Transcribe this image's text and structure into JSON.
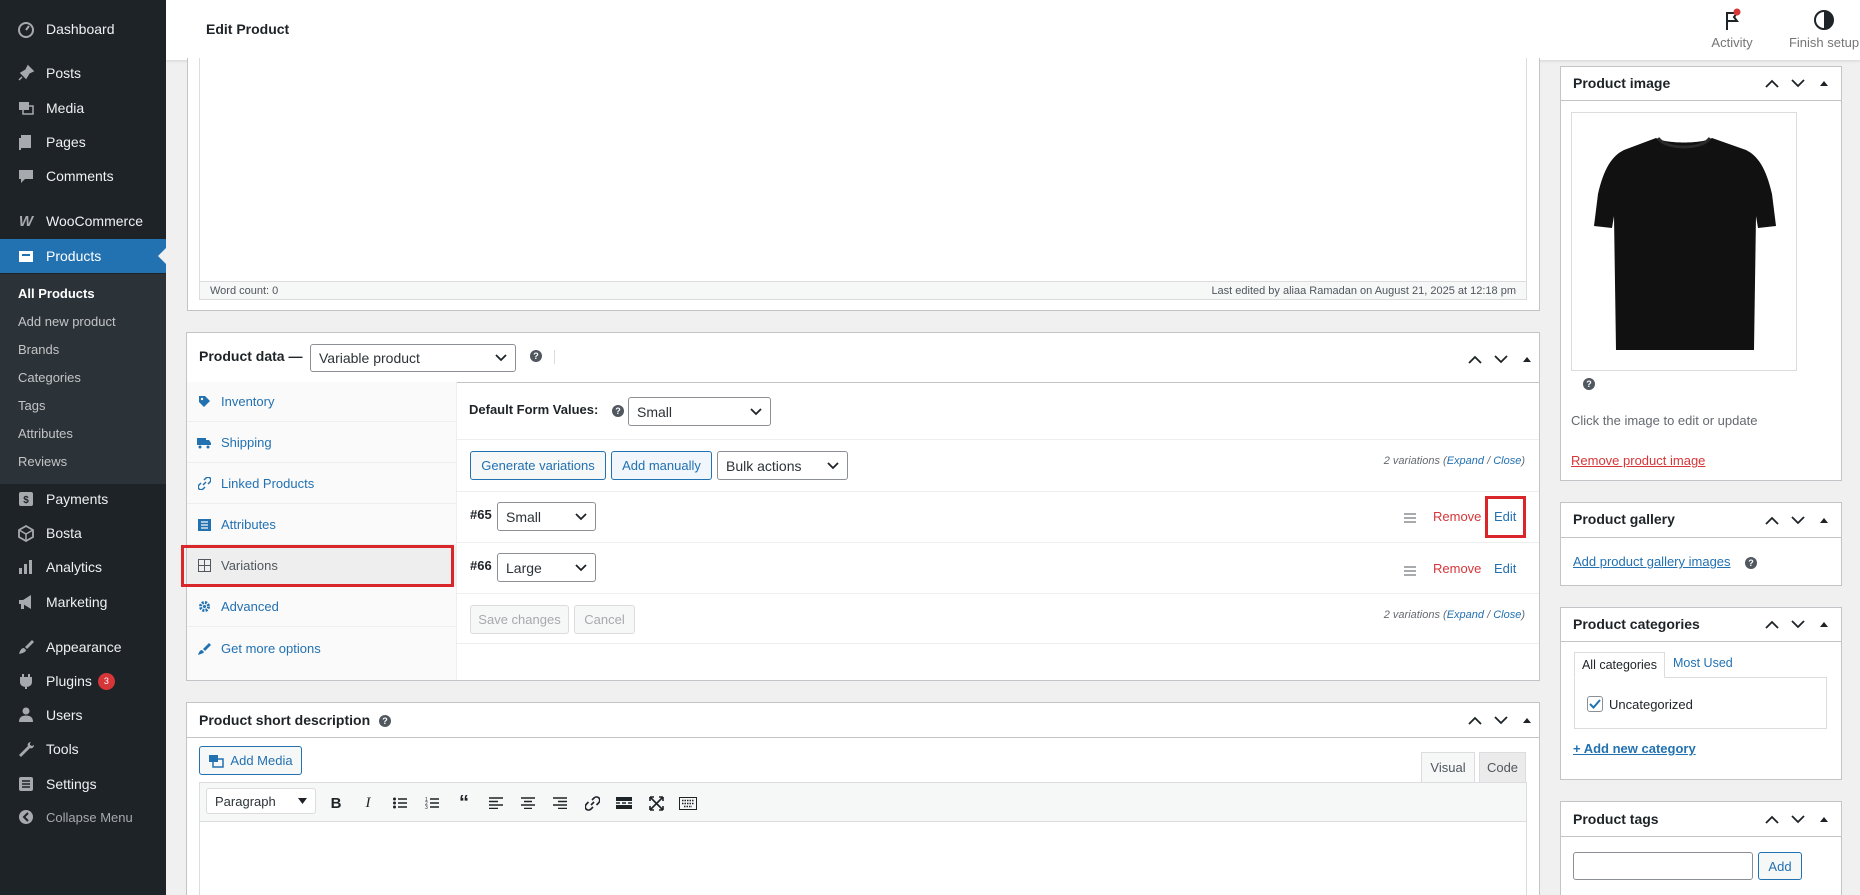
{
  "sidebar": {
    "items": [
      {
        "label": "Dashboard",
        "icon": "dashboard-icon"
      },
      {
        "label": "Posts",
        "icon": "pin-icon"
      },
      {
        "label": "Media",
        "icon": "media-icon"
      },
      {
        "label": "Pages",
        "icon": "pages-icon"
      },
      {
        "label": "Comments",
        "icon": "comments-icon"
      },
      {
        "label": "WooCommerce",
        "icon": "woocommerce-icon"
      },
      {
        "label": "Products",
        "icon": "products-icon"
      },
      {
        "label": "Payments",
        "icon": "payments-icon"
      },
      {
        "label": "Bosta",
        "icon": "bosta-icon"
      },
      {
        "label": "Analytics",
        "icon": "analytics-icon"
      },
      {
        "label": "Marketing",
        "icon": "marketing-icon"
      },
      {
        "label": "Appearance",
        "icon": "appearance-icon"
      },
      {
        "label": "Plugins",
        "icon": "plugins-icon",
        "badge": "3"
      },
      {
        "label": "Users",
        "icon": "users-icon"
      },
      {
        "label": "Tools",
        "icon": "tools-icon"
      },
      {
        "label": "Settings",
        "icon": "settings-icon"
      },
      {
        "label": "Collapse Menu",
        "icon": "collapse-icon"
      }
    ],
    "submenu": [
      "All Products",
      "Add new product",
      "Brands",
      "Categories",
      "Tags",
      "Attributes",
      "Reviews"
    ]
  },
  "topbar": {
    "title": "Edit Product",
    "activity": "Activity",
    "finish_setup": "Finish setup"
  },
  "editor": {
    "word_count": "Word count: 0",
    "last_edited": "Last edited by aliaa Ramadan on August 21, 2025 at 12:18 pm"
  },
  "product_data": {
    "title": "Product data —",
    "type": "Variable product",
    "tabs": [
      "Inventory",
      "Shipping",
      "Linked Products",
      "Attributes",
      "Variations",
      "Advanced",
      "Get more options"
    ],
    "default_form_label": "Default Form Values:",
    "default_form_value": "Small",
    "generate_btn": "Generate variations",
    "add_manually_btn": "Add manually",
    "bulk_actions": "Bulk actions",
    "variations_count": "2 variations (",
    "expand": "Expand",
    "slash": " / ",
    "close": "Close",
    "close_paren": ")",
    "variations": [
      {
        "id": "#65",
        "value": "Small",
        "remove": "Remove",
        "edit": "Edit"
      },
      {
        "id": "#66",
        "value": "Large",
        "remove": "Remove",
        "edit": "Edit"
      }
    ],
    "save_btn": "Save changes",
    "cancel_btn": "Cancel"
  },
  "short_desc": {
    "title": "Product short description",
    "add_media": "Add Media",
    "visual_tab": "Visual",
    "code_tab": "Code",
    "format": "Paragraph"
  },
  "product_image": {
    "title": "Product image",
    "hint": "Click the image to edit or update",
    "remove": "Remove product image"
  },
  "product_gallery": {
    "title": "Product gallery",
    "add": "Add product gallery images"
  },
  "product_categories": {
    "title": "Product categories",
    "tab_all": "All categories",
    "tab_used": "Most Used",
    "item": "Uncategorized",
    "add_new": "+ Add new category"
  },
  "product_tags": {
    "title": "Product tags",
    "add_btn": "Add"
  },
  "colors": {
    "accent": "#2271b1",
    "sidebar_bg": "#1d2327",
    "highlight": "#d9262b",
    "danger": "#d63638"
  }
}
